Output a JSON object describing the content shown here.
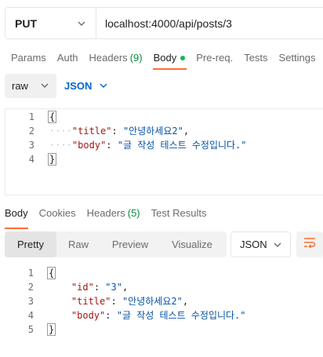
{
  "request": {
    "method": "PUT",
    "url": "localhost:4000/api/posts/3"
  },
  "request_tabs": [
    {
      "label": "Params"
    },
    {
      "label": "Auth"
    },
    {
      "label": "Headers",
      "count": "(9)"
    },
    {
      "label": "Body",
      "active": true
    },
    {
      "label": "Pre-req."
    },
    {
      "label": "Tests"
    },
    {
      "label": "Settings"
    }
  ],
  "body_mode": {
    "mode": "raw",
    "format": "JSON"
  },
  "request_body": {
    "line_numbers": [
      "1",
      "2",
      "3",
      "4"
    ],
    "lines": [
      {
        "open": "{"
      },
      {
        "key": "\"title\"",
        "sep": ": ",
        "value": "\"안녕하세요2\"",
        "trail": ","
      },
      {
        "key": "\"body\"",
        "sep": ": ",
        "value": "\"글 작성 테스트 수정입니다.\"",
        "trail": ""
      },
      {
        "close": "}"
      }
    ]
  },
  "response_tabs": [
    {
      "label": "Body",
      "active": true
    },
    {
      "label": "Cookies"
    },
    {
      "label": "Headers",
      "count": "(5)"
    },
    {
      "label": "Test Results"
    }
  ],
  "response_view": {
    "views": [
      "Pretty",
      "Raw",
      "Preview",
      "Visualize"
    ],
    "format": "JSON"
  },
  "response_body": {
    "line_numbers": [
      "1",
      "2",
      "3",
      "4",
      "5"
    ],
    "lines": [
      {
        "open": "{"
      },
      {
        "key": "\"id\"",
        "sep": ": ",
        "value": "\"3\"",
        "trail": ","
      },
      {
        "key": "\"title\"",
        "sep": ": ",
        "value": "\"안녕하세요2\"",
        "trail": ","
      },
      {
        "key": "\"body\"",
        "sep": ": ",
        "value": "\"글 작성 테스트 수정입니다.\"",
        "trail": ""
      },
      {
        "close": "}"
      }
    ]
  },
  "colors": {
    "accent": "#ff6c37",
    "json_link": "#0265d2",
    "count_green": "#078a3e",
    "status_dot": "#0cbb52"
  }
}
